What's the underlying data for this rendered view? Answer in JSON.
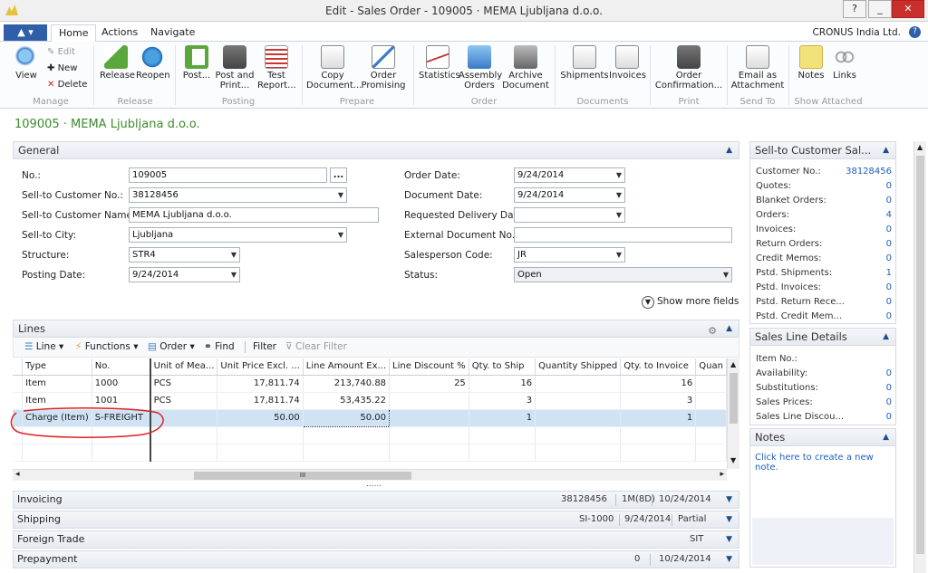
{
  "window": {
    "title": "Edit - Sales Order - 109005 · MEMA Ljubljana d.o.o.",
    "help": "?",
    "minimize": "_",
    "maximize": "□",
    "close": "✕"
  },
  "tabs": {
    "home": "Home",
    "actions": "Actions",
    "navigate": "Navigate"
  },
  "company": "CRONUS India Ltd.",
  "ribbon": {
    "manage": {
      "label": "Manage",
      "view": "View",
      "edit": "Edit",
      "new": "New",
      "delete": "Delete"
    },
    "release": {
      "label": "Release",
      "release": "Release",
      "reopen": "Reopen"
    },
    "posting": {
      "label": "Posting",
      "post": "Post...",
      "post_print": "Post and Print...",
      "test_report": "Test Report..."
    },
    "prepare": {
      "label": "Prepare",
      "copy": "Copy Document...",
      "order_promising": "Order Promising"
    },
    "order": {
      "label": "Order",
      "statistics": "Statistics",
      "assembly": "Assembly Orders",
      "archive": "Archive Document"
    },
    "documents": {
      "label": "Documents",
      "shipments": "Shipments",
      "invoices": "Invoices"
    },
    "print": {
      "label": "Print",
      "order_conf": "Order Confirmation..."
    },
    "sendto": {
      "label": "Send To",
      "email": "Email as Attachment"
    },
    "showattached": {
      "label": "Show Attached",
      "notes": "Notes",
      "links": "Links"
    }
  },
  "page_title": "109005 · MEMA Ljubljana d.o.o.",
  "general": {
    "header": "General",
    "no_label": "No.:",
    "no": "109005",
    "ellipsis": "...",
    "cust_no_label": "Sell-to Customer No.:",
    "cust_no": "38128456",
    "cust_name_label": "Sell-to Customer Name:",
    "cust_name": "MEMA Ljubljana d.o.o.",
    "city_label": "Sell-to City:",
    "city": "Ljubljana",
    "structure_label": "Structure:",
    "structure": "STR4",
    "posting_date_label": "Posting Date:",
    "posting_date": "9/24/2014",
    "order_date_label": "Order Date:",
    "order_date": "9/24/2014",
    "doc_date_label": "Document Date:",
    "doc_date": "9/24/2014",
    "req_del_label": "Requested Delivery Date:",
    "req_del": "",
    "ext_doc_label": "External Document No.:",
    "ext_doc": "",
    "salesperson_label": "Salesperson Code:",
    "salesperson": "JR",
    "status_label": "Status:",
    "status": "Open",
    "show_more": "Show more fields"
  },
  "lines": {
    "header": "Lines",
    "toolbar": {
      "line": "Line",
      "functions": "Functions",
      "order": "Order",
      "find": "Find",
      "filter": "Filter",
      "clear_filter": "Clear Filter"
    },
    "columns": [
      "Type",
      "No.",
      "Unit of Mea...",
      "Unit Price Excl. ...",
      "Line Amount Ex...",
      "Line Discount %",
      "Qty. to Ship",
      "Quantity Shipped",
      "Qty. to Invoice",
      "Quan"
    ],
    "rows": [
      [
        "Item",
        "1000",
        "PCS",
        "17,811.74",
        "213,740.88",
        "25",
        "16",
        "",
        "16",
        ""
      ],
      [
        "Item",
        "1001",
        "PCS",
        "17,811.74",
        "53,435.22",
        "",
        "3",
        "",
        "3",
        ""
      ],
      [
        "Charge (Item)",
        "S-FREIGHT",
        "",
        "50.00",
        "50.00",
        "",
        "1",
        "",
        "1",
        ""
      ]
    ],
    "hscroll": "III",
    "splitter": "......"
  },
  "invoicing": {
    "label": "Invoicing",
    "v1": "38128456",
    "v2": "1M(8D)",
    "v3": "10/24/2014"
  },
  "shipping": {
    "label": "Shipping",
    "v1": "SI-1000",
    "v2": "9/24/2014",
    "v3": "Partial"
  },
  "foreign": {
    "label": "Foreign Trade",
    "v1": "SIT"
  },
  "prepayment": {
    "label": "Prepayment",
    "v1": "0",
    "v2": "10/24/2014"
  },
  "factbox_customer": {
    "header": "Sell-to Customer Sal...",
    "rows": [
      {
        "label": "Customer No.:",
        "value": "38128456"
      },
      {
        "label": "Quotes:",
        "value": "0"
      },
      {
        "label": "Blanket Orders:",
        "value": "0"
      },
      {
        "label": "Orders:",
        "value": "4"
      },
      {
        "label": "Invoices:",
        "value": "0"
      },
      {
        "label": "Return Orders:",
        "value": "0"
      },
      {
        "label": "Credit Memos:",
        "value": "0"
      },
      {
        "label": "Pstd. Shipments:",
        "value": "1"
      },
      {
        "label": "Pstd. Invoices:",
        "value": "0"
      },
      {
        "label": "Pstd. Return Rece...",
        "value": "0"
      },
      {
        "label": "Pstd. Credit Mem...",
        "value": "0"
      }
    ]
  },
  "factbox_sales_line": {
    "header": "Sales Line Details",
    "rows": [
      {
        "label": "Item No.:",
        "value": ""
      },
      {
        "label": "Availability:",
        "value": "0"
      },
      {
        "label": "Substitutions:",
        "value": "0"
      },
      {
        "label": "Sales Prices:",
        "value": "0"
      },
      {
        "label": "Sales Line Discou...",
        "value": "0"
      }
    ]
  },
  "notes": {
    "header": "Notes",
    "link": "Click here to create a new note."
  },
  "colors": {
    "accent": "#2e5fa8",
    "title_green": "#3d8b2c",
    "selection": "#cfe3f5",
    "annotation": "#e02020"
  }
}
